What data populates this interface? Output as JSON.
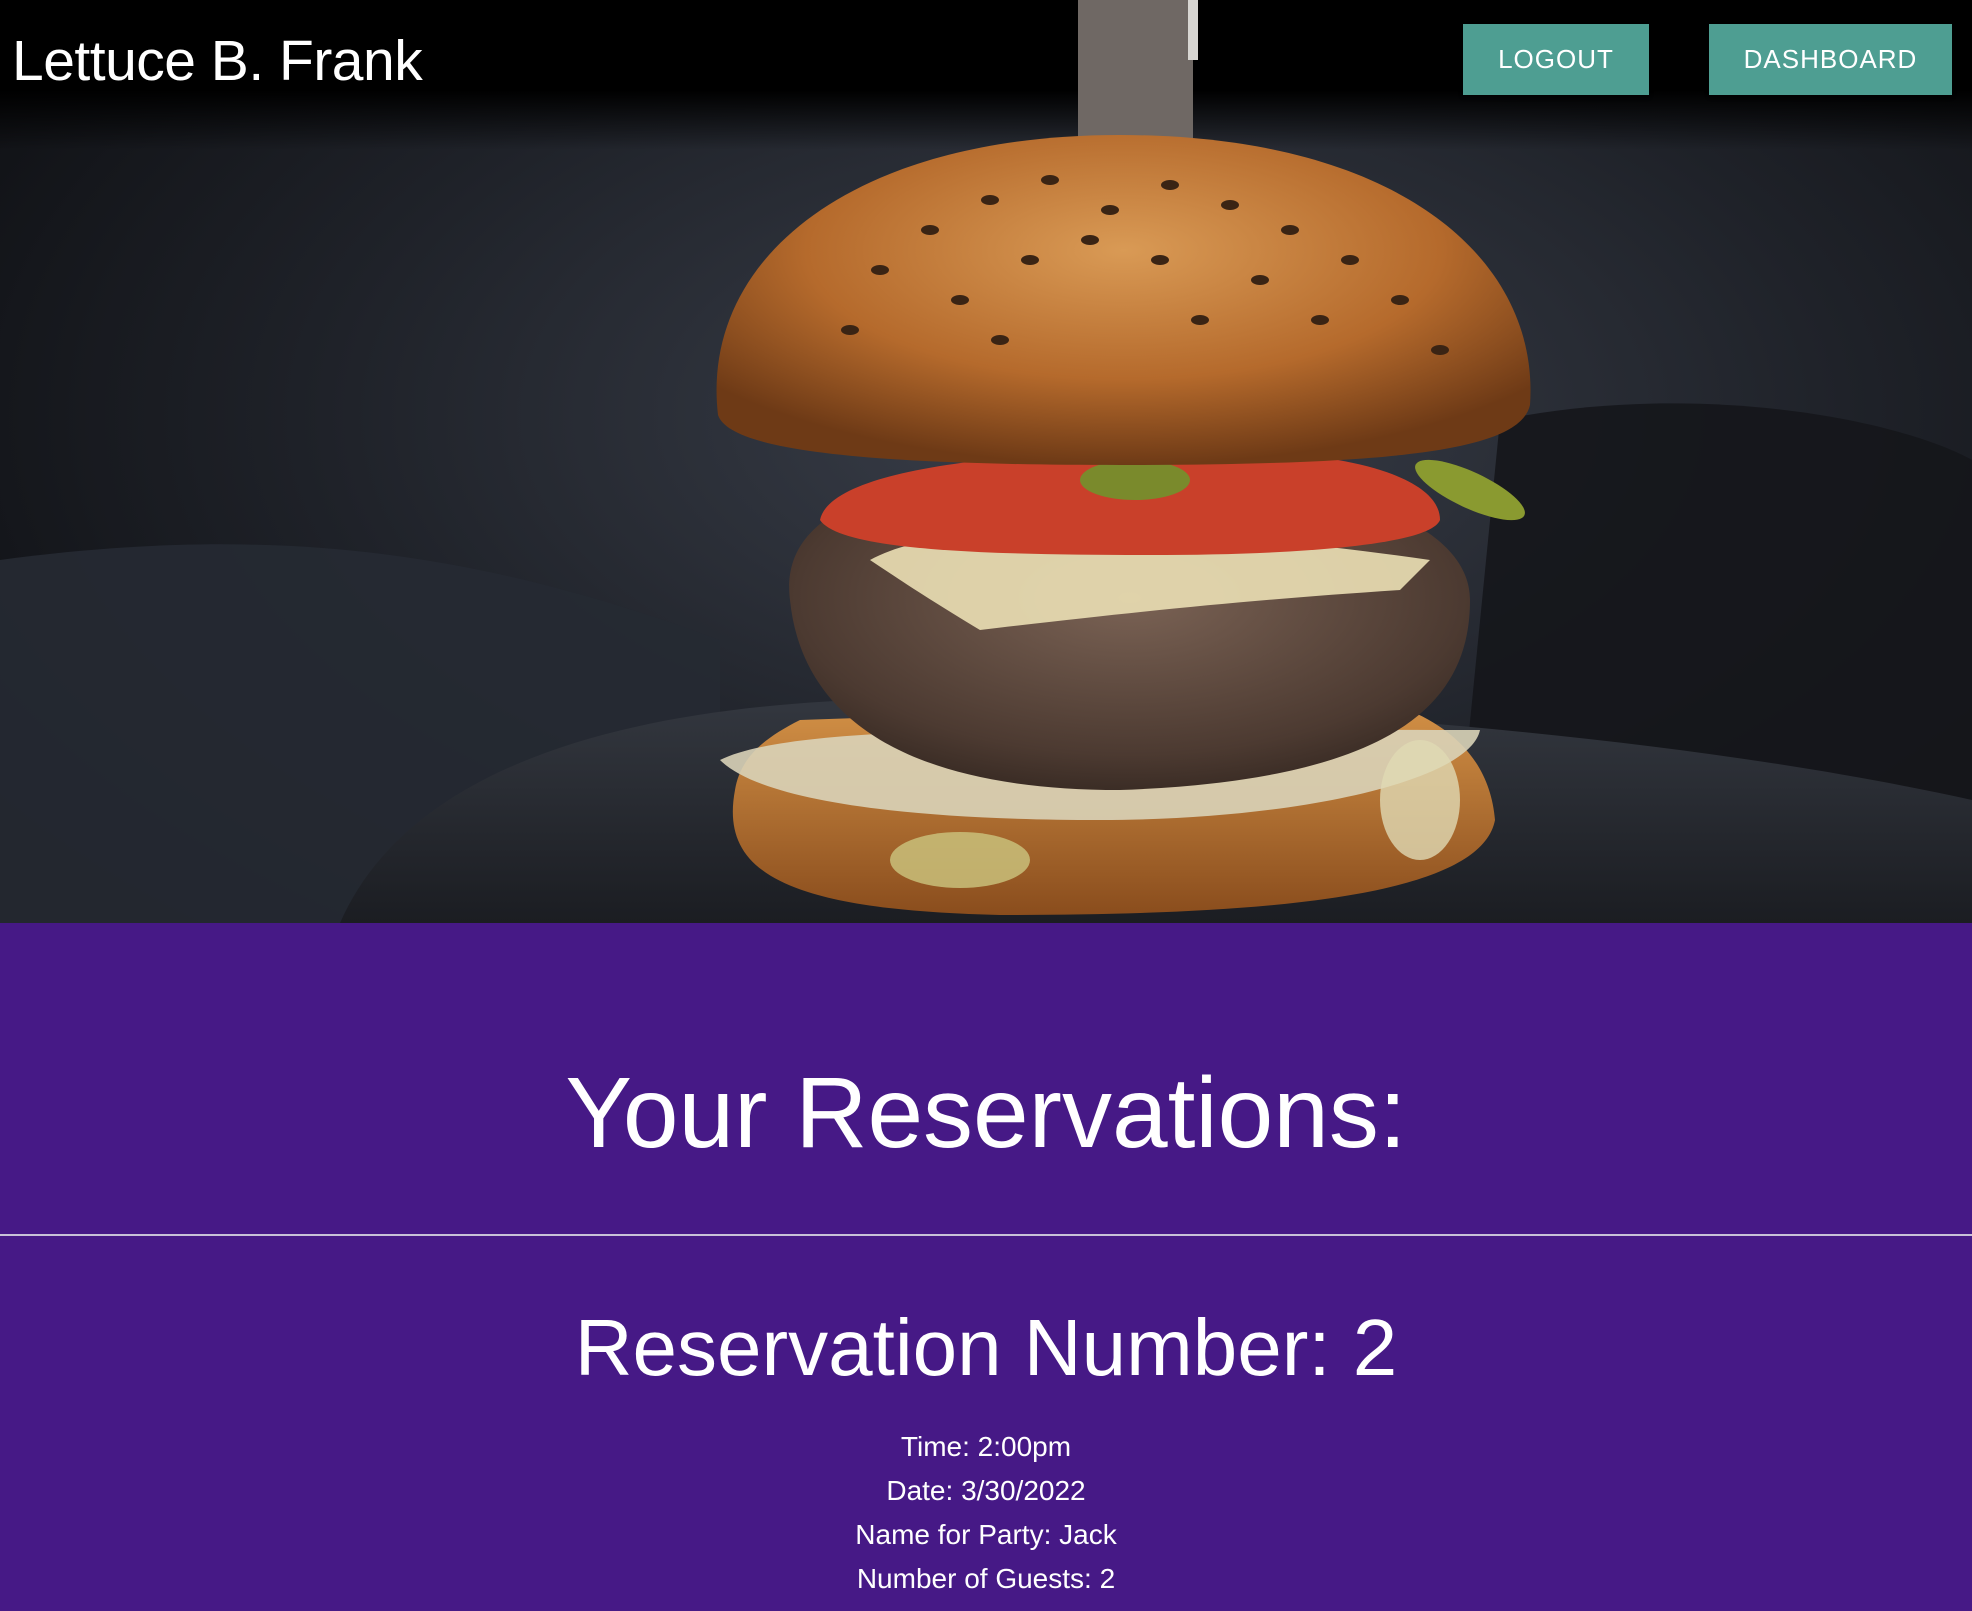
{
  "header": {
    "brand": "Lettuce B. Frank",
    "logout_label": "LOGOUT",
    "dashboard_label": "DASHBOARD"
  },
  "hero": {
    "image_subject": "burger-photo"
  },
  "main": {
    "title": "Your Reservations:",
    "reservations": [
      {
        "number_label": "Reservation Number: 2",
        "time": "Time: 2:00pm",
        "date": "Date: 3/30/2022",
        "party_name": "Name for Party: Jack",
        "guests": "Number of Guests: 2"
      }
    ]
  },
  "colors": {
    "background": "#461986",
    "button": "#4e9e92",
    "text": "#ffffff"
  }
}
